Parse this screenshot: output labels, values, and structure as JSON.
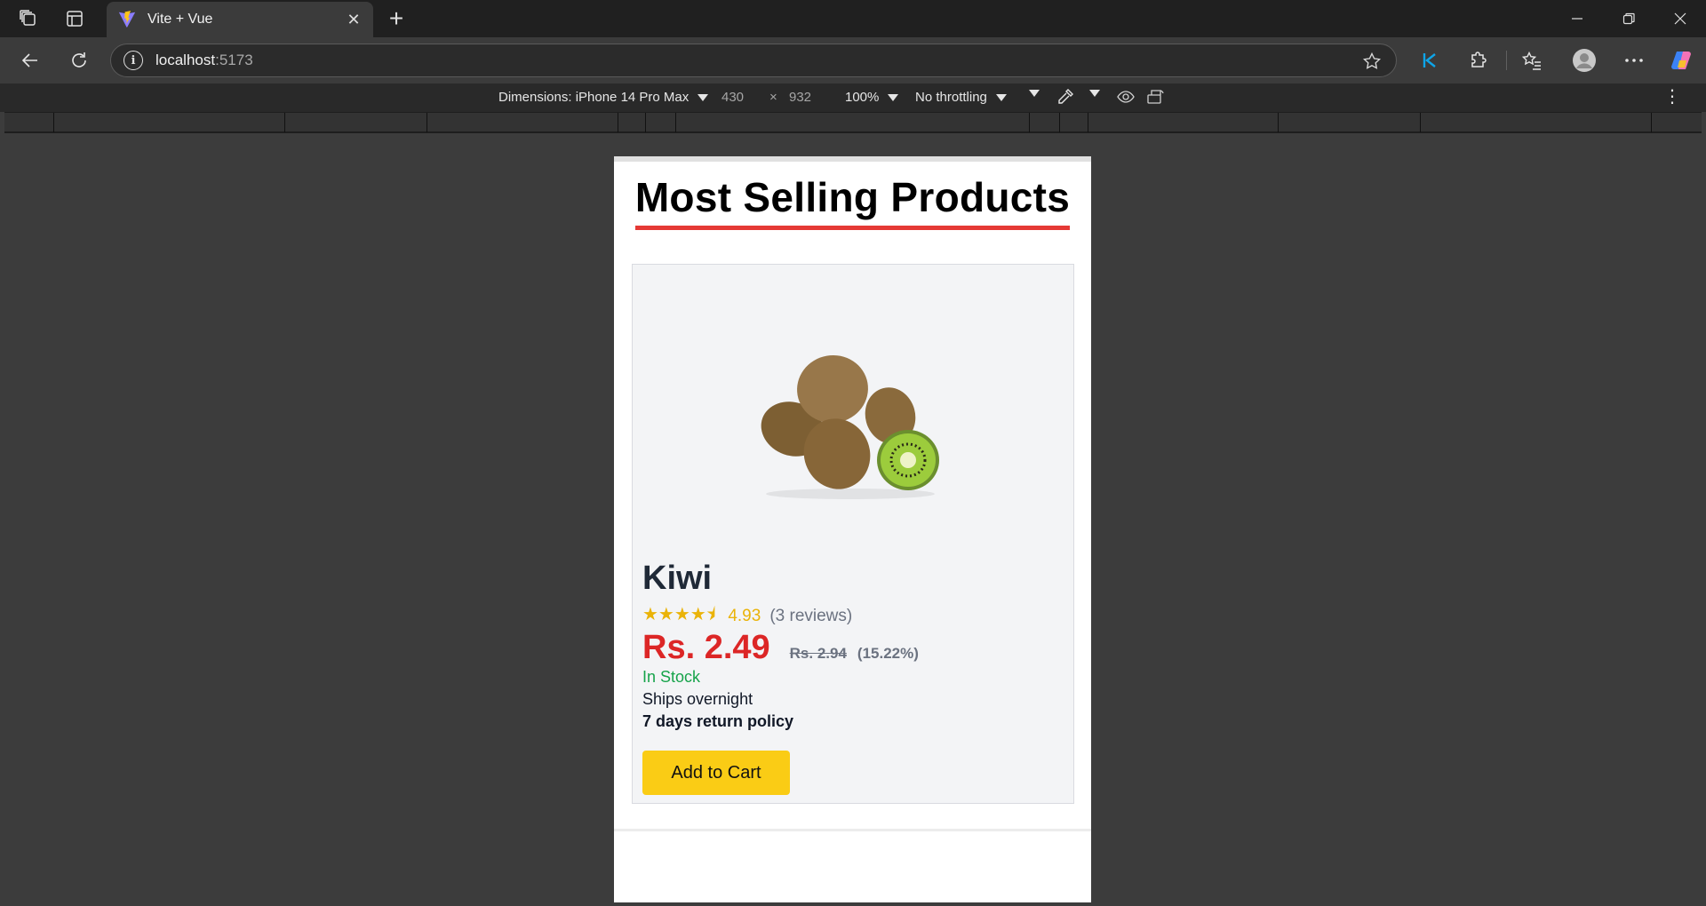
{
  "browser": {
    "tab": {
      "title": "Vite + Vue"
    },
    "url": {
      "host": "localhost",
      "port": ":5173"
    }
  },
  "devtools": {
    "dimensions_label": "Dimensions: iPhone 14 Pro Max",
    "width": "430",
    "times": "×",
    "height": "932",
    "zoom": "100%",
    "throttling": "No throttling"
  },
  "page": {
    "heading": "Most Selling Products",
    "product": {
      "name": "Kiwi",
      "stars": "★★★★⯨",
      "rating": "4.93",
      "reviews": "(3 reviews)",
      "price": "Rs. 2.49",
      "old_price": "Rs. 2.94",
      "discount": "(15.22%)",
      "stock": "In Stock",
      "shipping": "Ships overnight",
      "returns": "7 days return policy",
      "cta": "Add to Cart",
      "image": "kiwi-fruit-image"
    }
  },
  "colors": {
    "accent_underline": "#e53935",
    "price": "#dc2626",
    "stars": "#eab308",
    "in_stock": "#16a34a",
    "button": "#facc15",
    "edge_accent": "#0ea5e9"
  }
}
